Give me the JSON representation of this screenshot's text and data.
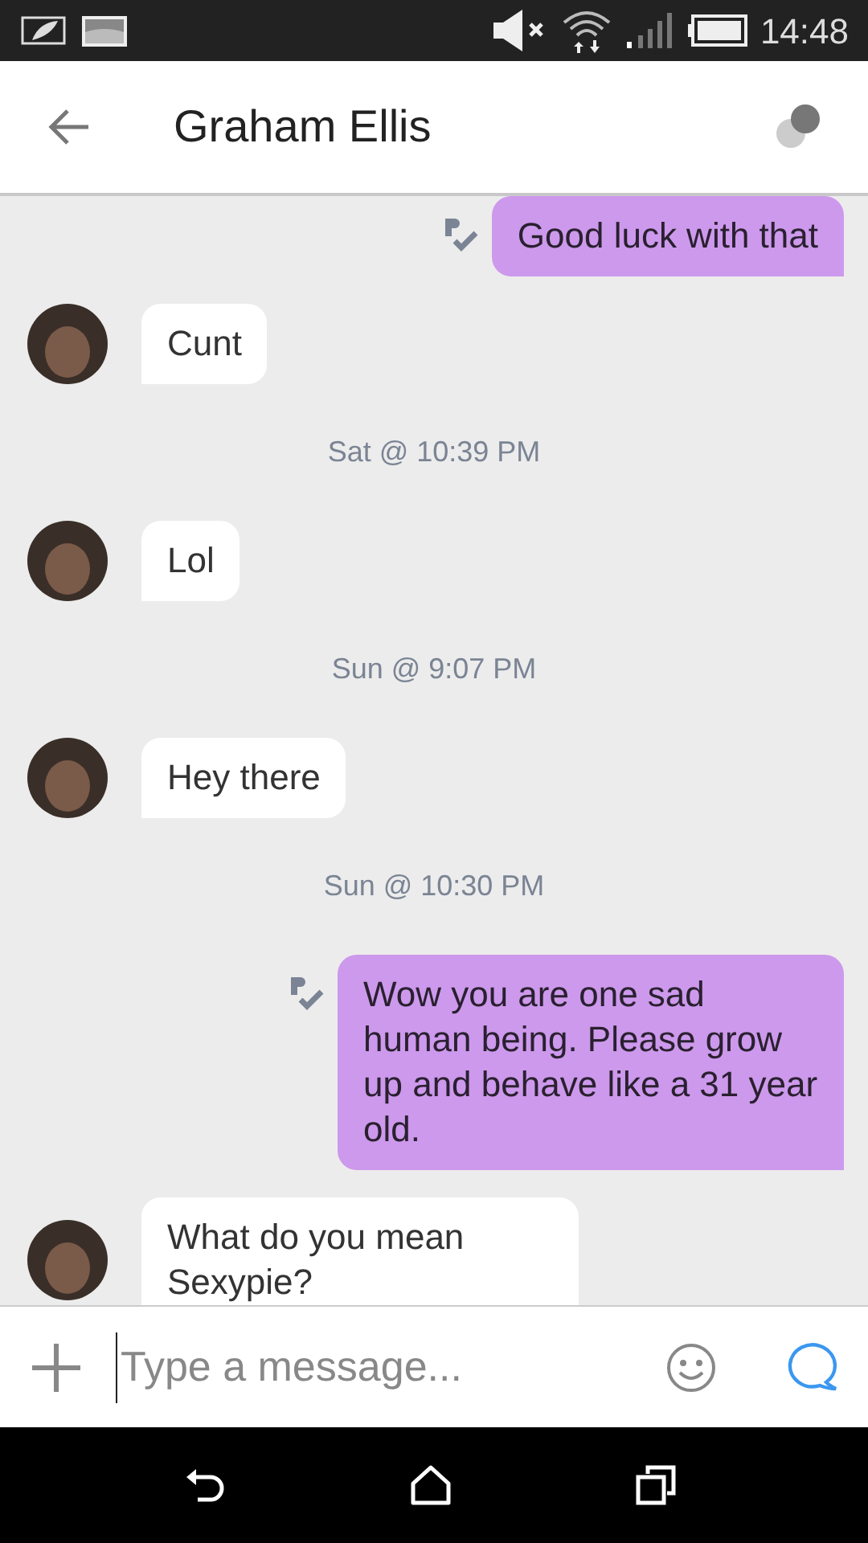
{
  "status_bar": {
    "time": "14:48"
  },
  "header": {
    "title": "Graham Ellis"
  },
  "messages": [
    {
      "kind": "outgoing",
      "text": "Good luck with that",
      "read": true
    },
    {
      "kind": "incoming",
      "text": "Cunt"
    },
    {
      "kind": "timestamp",
      "text": "Sat @ 10:39 PM"
    },
    {
      "kind": "incoming",
      "text": "Lol"
    },
    {
      "kind": "timestamp",
      "text": "Sun @ 9:07 PM"
    },
    {
      "kind": "incoming",
      "text": "Hey there"
    },
    {
      "kind": "timestamp",
      "text": "Sun @ 10:30 PM"
    },
    {
      "kind": "outgoing",
      "text": "Wow you are one sad human being. Please grow up and behave like a 31 year old.",
      "read": true
    },
    {
      "kind": "incoming",
      "text": "What do you mean Sexypie?"
    }
  ],
  "composer": {
    "placeholder": "Type a message..."
  }
}
